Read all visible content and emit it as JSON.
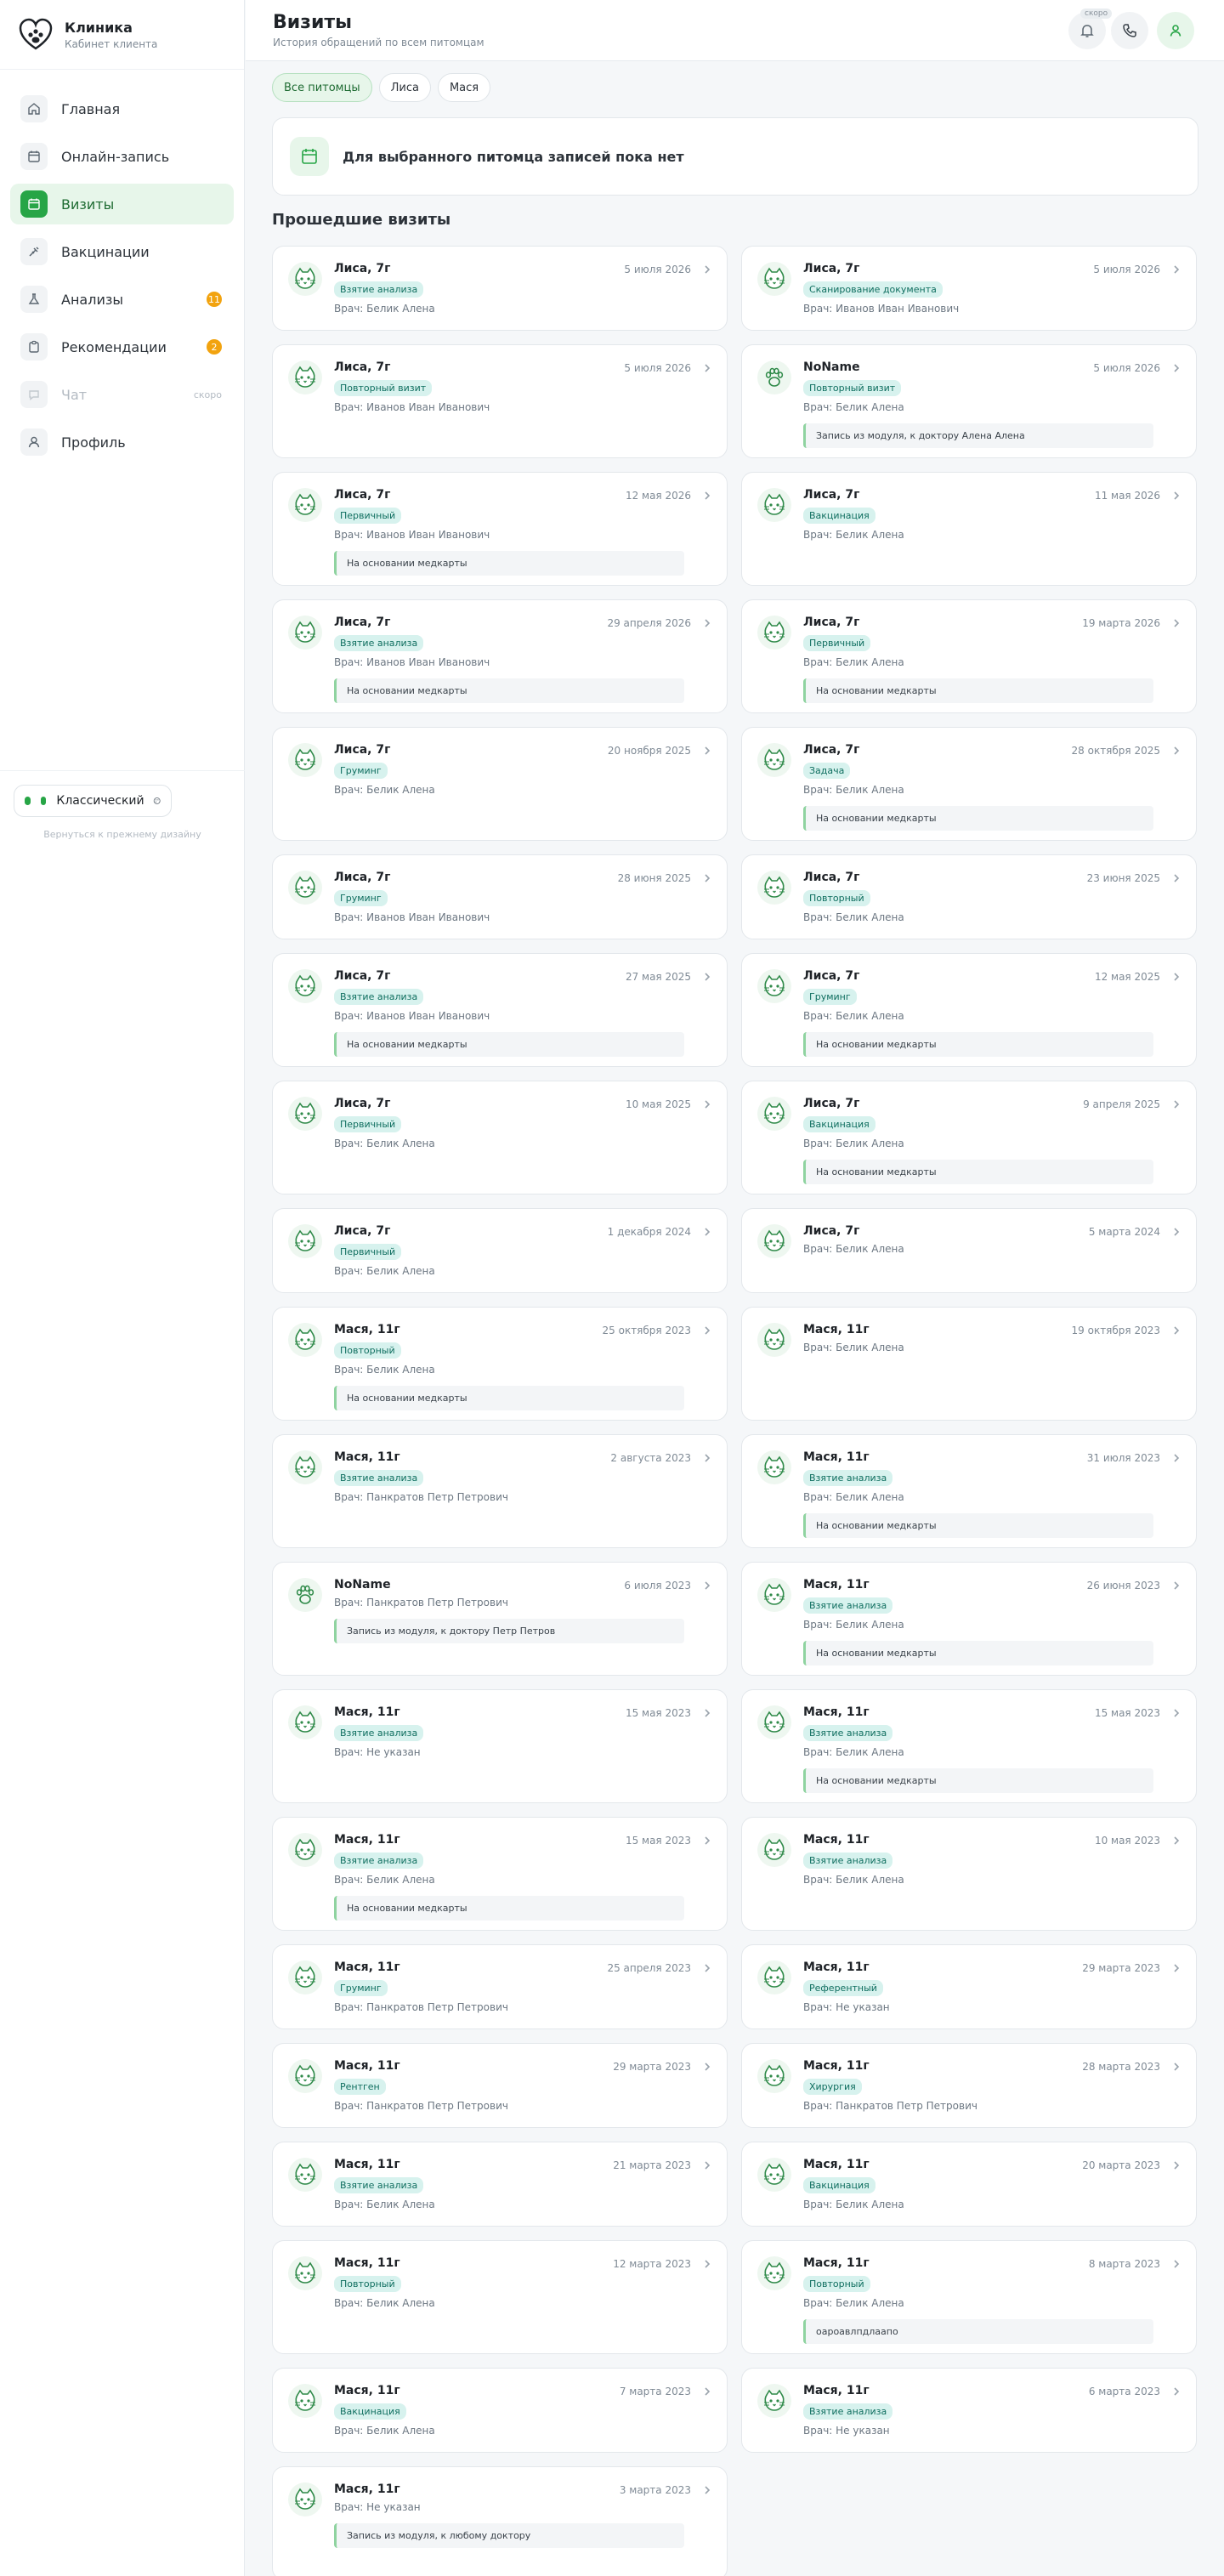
{
  "brand": {
    "name": "Клиника",
    "subtitle": "Кабинет клиента"
  },
  "nav": [
    {
      "label": "Главная",
      "icon": "home-icon"
    },
    {
      "label": "Онлайн-запись",
      "icon": "calendar-plus-icon"
    },
    {
      "label": "Визиты",
      "icon": "calendar-icon",
      "active": true
    },
    {
      "label": "Вакцинации",
      "icon": "syringe-icon"
    },
    {
      "label": "Анализы",
      "icon": "flask-icon",
      "badge": "11"
    },
    {
      "label": "Рекомендации",
      "icon": "clipboard-icon",
      "badge": "2"
    },
    {
      "label": "Чат",
      "icon": "chat-icon",
      "soon": "скоро",
      "disabled": true
    },
    {
      "label": "Профиль",
      "icon": "user-icon"
    }
  ],
  "theme": {
    "label": "Классический",
    "return_link": "Вернуться к прежнему дизайну"
  },
  "header": {
    "title": "Визиты",
    "subtitle": "История обращений по всем питомцам",
    "soon_badge": "скоро"
  },
  "filters": [
    {
      "label": "Все питомцы",
      "active": true
    },
    {
      "label": "Лиса",
      "active": false
    },
    {
      "label": "Мася",
      "active": false
    }
  ],
  "empty_state": "Для выбранного питомца записей пока нет",
  "past_title": "Прошедшие визиты",
  "visits": [
    {
      "pet": "Лиса, 7г",
      "date": "5 июля 2026",
      "tag": "Взятие анализа",
      "doctor": "Врач: Белик Алена",
      "note": "",
      "avatar": "cat"
    },
    {
      "pet": "Лиса, 7г",
      "date": "5 июля 2026",
      "tag": "Сканирование документа",
      "doctor": "Врач: Иванов Иван Иванович",
      "note": "",
      "avatar": "cat"
    },
    {
      "pet": "Лиса, 7г",
      "date": "5 июля 2026",
      "tag": "Повторный визит",
      "doctor": "Врач: Иванов Иван Иванович",
      "note": "",
      "avatar": "cat"
    },
    {
      "pet": "NoName",
      "date": "5 июля 2026",
      "tag": "Повторный визит",
      "doctor": "Врач: Белик Алена",
      "note": "Запись из модуля, к доктору Алена Алена",
      "avatar": "paw"
    },
    {
      "pet": "Лиса, 7г",
      "date": "12 мая 2026",
      "tag": "Первичный",
      "doctor": "Врач: Иванов Иван Иванович",
      "note": "На основании медкарты",
      "avatar": "cat"
    },
    {
      "pet": "Лиса, 7г",
      "date": "11 мая 2026",
      "tag": "Вакцинация",
      "doctor": "Врач: Белик Алена",
      "note": "",
      "avatar": "cat"
    },
    {
      "pet": "Лиса, 7г",
      "date": "29 апреля 2026",
      "tag": "Взятие анализа",
      "doctor": "Врач: Иванов Иван Иванович",
      "note": "На основании медкарты",
      "avatar": "cat"
    },
    {
      "pet": "Лиса, 7г",
      "date": "19 марта 2026",
      "tag": "Первичный",
      "doctor": "Врач: Белик Алена",
      "note": "На основании медкарты",
      "avatar": "cat"
    },
    {
      "pet": "Лиса, 7г",
      "date": "20 ноября 2025",
      "tag": "Груминг",
      "doctor": "Врач: Белик Алена",
      "note": "",
      "avatar": "cat"
    },
    {
      "pet": "Лиса, 7г",
      "date": "28 октября 2025",
      "tag": "Задача",
      "doctor": "Врач: Белик Алена",
      "note": "На основании медкарты",
      "avatar": "cat"
    },
    {
      "pet": "Лиса, 7г",
      "date": "28 июня 2025",
      "tag": "Груминг",
      "doctor": "Врач: Иванов Иван Иванович",
      "note": "",
      "avatar": "cat"
    },
    {
      "pet": "Лиса, 7г",
      "date": "23 июня 2025",
      "tag": "Повторный",
      "doctor": "Врач: Белик Алена",
      "note": "",
      "avatar": "cat"
    },
    {
      "pet": "Лиса, 7г",
      "date": "27 мая 2025",
      "tag": "Взятие анализа",
      "doctor": "Врач: Иванов Иван Иванович",
      "note": "На основании медкарты",
      "avatar": "cat"
    },
    {
      "pet": "Лиса, 7г",
      "date": "12 мая 2025",
      "tag": "Груминг",
      "doctor": "Врач: Белик Алена",
      "note": "На основании медкарты",
      "avatar": "cat"
    },
    {
      "pet": "Лиса, 7г",
      "date": "10 мая 2025",
      "tag": "Первичный",
      "doctor": "Врач: Белик Алена",
      "note": "",
      "avatar": "cat"
    },
    {
      "pet": "Лиса, 7г",
      "date": "9 апреля 2025",
      "tag": "Вакцинация",
      "doctor": "Врач: Белик Алена",
      "note": "На основании медкарты",
      "avatar": "cat"
    },
    {
      "pet": "Лиса, 7г",
      "date": "1 декабря 2024",
      "tag": "Первичный",
      "doctor": "Врач: Белик Алена",
      "note": "",
      "avatar": "cat"
    },
    {
      "pet": "Лиса, 7г",
      "date": "5 марта 2024",
      "tag": "",
      "doctor": "Врач: Белик Алена",
      "note": "",
      "avatar": "cat"
    },
    {
      "pet": "Мася, 11г",
      "date": "25 октября 2023",
      "tag": "Повторный",
      "doctor": "Врач: Белик Алена",
      "note": "На основании медкарты",
      "avatar": "cat"
    },
    {
      "pet": "Мася, 11г",
      "date": "19 октября 2023",
      "tag": "",
      "doctor": "Врач: Белик Алена",
      "note": "",
      "avatar": "cat"
    },
    {
      "pet": "Мася, 11г",
      "date": "2 августа 2023",
      "tag": "Взятие анализа",
      "doctor": "Врач: Панкратов Петр Петрович",
      "note": "",
      "avatar": "cat"
    },
    {
      "pet": "Мася, 11г",
      "date": "31 июля 2023",
      "tag": "Взятие анализа",
      "doctor": "Врач: Белик Алена",
      "note": "На основании медкарты",
      "avatar": "cat"
    },
    {
      "pet": "NoName",
      "date": "6 июля 2023",
      "tag": "",
      "doctor": "Врач: Панкратов Петр Петрович",
      "note": "Запись из модуля, к доктору Петр Петров",
      "avatar": "paw"
    },
    {
      "pet": "Мася, 11г",
      "date": "26 июня 2023",
      "tag": "Взятие анализа",
      "doctor": "Врач: Белик Алена",
      "note": "На основании медкарты",
      "avatar": "cat"
    },
    {
      "pet": "Мася, 11г",
      "date": "15 мая 2023",
      "tag": "Взятие анализа",
      "doctor": "Врач: Не указан",
      "note": "",
      "avatar": "cat"
    },
    {
      "pet": "Мася, 11г",
      "date": "15 мая 2023",
      "tag": "Взятие анализа",
      "doctor": "Врач: Белик Алена",
      "note": "На основании медкарты",
      "avatar": "cat"
    },
    {
      "pet": "Мася, 11г",
      "date": "15 мая 2023",
      "tag": "Взятие анализа",
      "doctor": "Врач: Белик Алена",
      "note": "На основании медкарты",
      "avatar": "cat"
    },
    {
      "pet": "Мася, 11г",
      "date": "10 мая 2023",
      "tag": "Взятие анализа",
      "doctor": "Врач: Белик Алена",
      "note": "",
      "avatar": "cat"
    },
    {
      "pet": "Мася, 11г",
      "date": "25 апреля 2023",
      "tag": "Груминг",
      "doctor": "Врач: Панкратов Петр Петрович",
      "note": "",
      "avatar": "cat"
    },
    {
      "pet": "Мася, 11г",
      "date": "29 марта 2023",
      "tag": "Референтный",
      "doctor": "Врач: Не указан",
      "note": "",
      "avatar": "cat"
    },
    {
      "pet": "Мася, 11г",
      "date": "29 марта 2023",
      "tag": "Рентген",
      "doctor": "Врач: Панкратов Петр Петрович",
      "note": "",
      "avatar": "cat"
    },
    {
      "pet": "Мася, 11г",
      "date": "28 марта 2023",
      "tag": "Хирургия",
      "doctor": "Врач: Панкратов Петр Петрович",
      "note": "",
      "avatar": "cat"
    },
    {
      "pet": "Мася, 11г",
      "date": "21 марта 2023",
      "tag": "Взятие анализа",
      "doctor": "Врач: Белик Алена",
      "note": "",
      "avatar": "cat"
    },
    {
      "pet": "Мася, 11г",
      "date": "20 марта 2023",
      "tag": "Вакцинация",
      "doctor": "Врач: Белик Алена",
      "note": "",
      "avatar": "cat"
    },
    {
      "pet": "Мася, 11г",
      "date": "12 марта 2023",
      "tag": "Повторный",
      "doctor": "Врач: Белик Алена",
      "note": "",
      "avatar": "cat"
    },
    {
      "pet": "Мася, 11г",
      "date": "8 марта 2023",
      "tag": "Повторный",
      "doctor": "Врач: Белик Алена",
      "note": "оароавлпдлаапо",
      "avatar": "cat"
    },
    {
      "pet": "Мася, 11г",
      "date": "7 марта 2023",
      "tag": "Вакцинация",
      "doctor": "Врач: Белик Алена",
      "note": "",
      "avatar": "cat"
    },
    {
      "pet": "Мася, 11г",
      "date": "6 марта 2023",
      "tag": "Взятие анализа",
      "doctor": "Врач: Не указан",
      "note": "",
      "avatar": "cat"
    },
    {
      "pet": "Мася, 11г",
      "date": "3 марта 2023",
      "tag": "",
      "doctor": "Врач: Не указан",
      "note": "Запись из модуля, к любому доктору",
      "avatar": "cat"
    }
  ],
  "colors": {
    "accent": "#27a546",
    "tag_bg": "#d7f2ee",
    "badge": "#f2a30f"
  }
}
